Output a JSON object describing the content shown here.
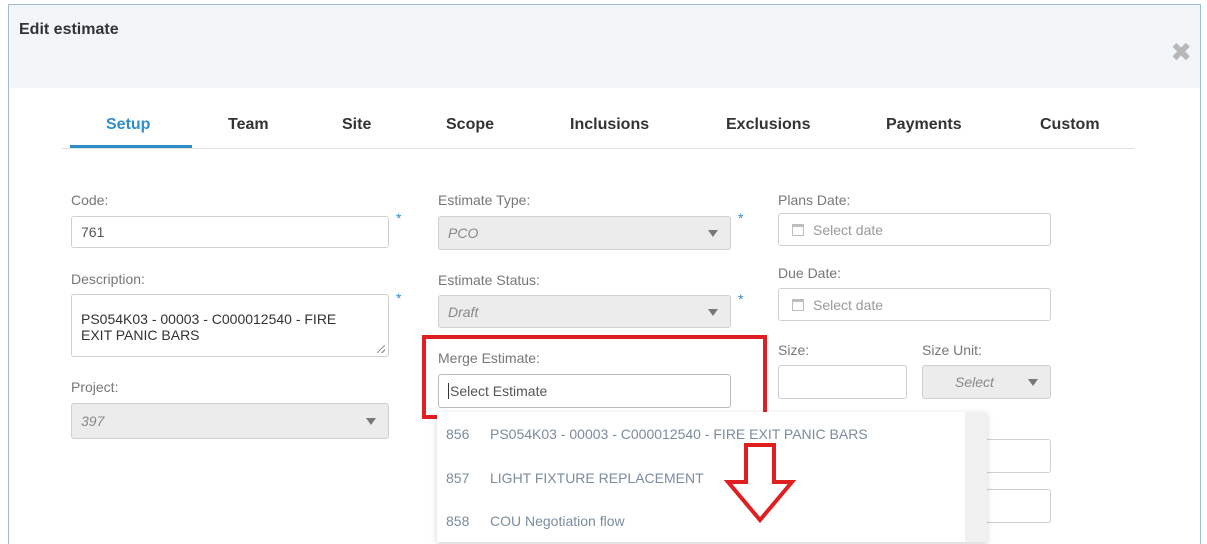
{
  "modal": {
    "title": "Edit estimate",
    "close_glyph": "✖"
  },
  "tabs": [
    "Setup",
    "Team",
    "Site",
    "Scope",
    "Inclusions",
    "Exclusions",
    "Payments",
    "Custom"
  ],
  "active_tab": "Setup",
  "form": {
    "code_label": "Code:",
    "code_value": "761",
    "description_label": "Description:",
    "description_value": "PS054K03 - 00003 - C000012540 - FIRE EXIT PANIC BARS",
    "project_label": "Project:",
    "project_value": "397",
    "estimate_type_label": "Estimate Type:",
    "estimate_type_value": "PCO",
    "estimate_status_label": "Estimate Status:",
    "estimate_status_value": "Draft",
    "merge_label": "Merge Estimate:",
    "merge_placeholder": "Select Estimate",
    "plans_date_label": "Plans Date:",
    "plans_date_placeholder": "Select date",
    "due_date_label": "Due Date:",
    "due_date_placeholder": "Select date",
    "size_label": "Size:",
    "size_unit_label": "Size Unit:",
    "size_unit_value": "Select",
    "required_marker": "*"
  },
  "merge_options": [
    {
      "num": "856",
      "text": "PS054K03 - 00003 - C000012540 - FIRE EXIT PANIC BARS"
    },
    {
      "num": "857",
      "text": "LIGHT FIXTURE REPLACEMENT"
    },
    {
      "num": "858",
      "text": "COU Negotiation flow"
    }
  ],
  "colors": {
    "accent": "#2f8ec9",
    "highlight": "#e02020"
  }
}
